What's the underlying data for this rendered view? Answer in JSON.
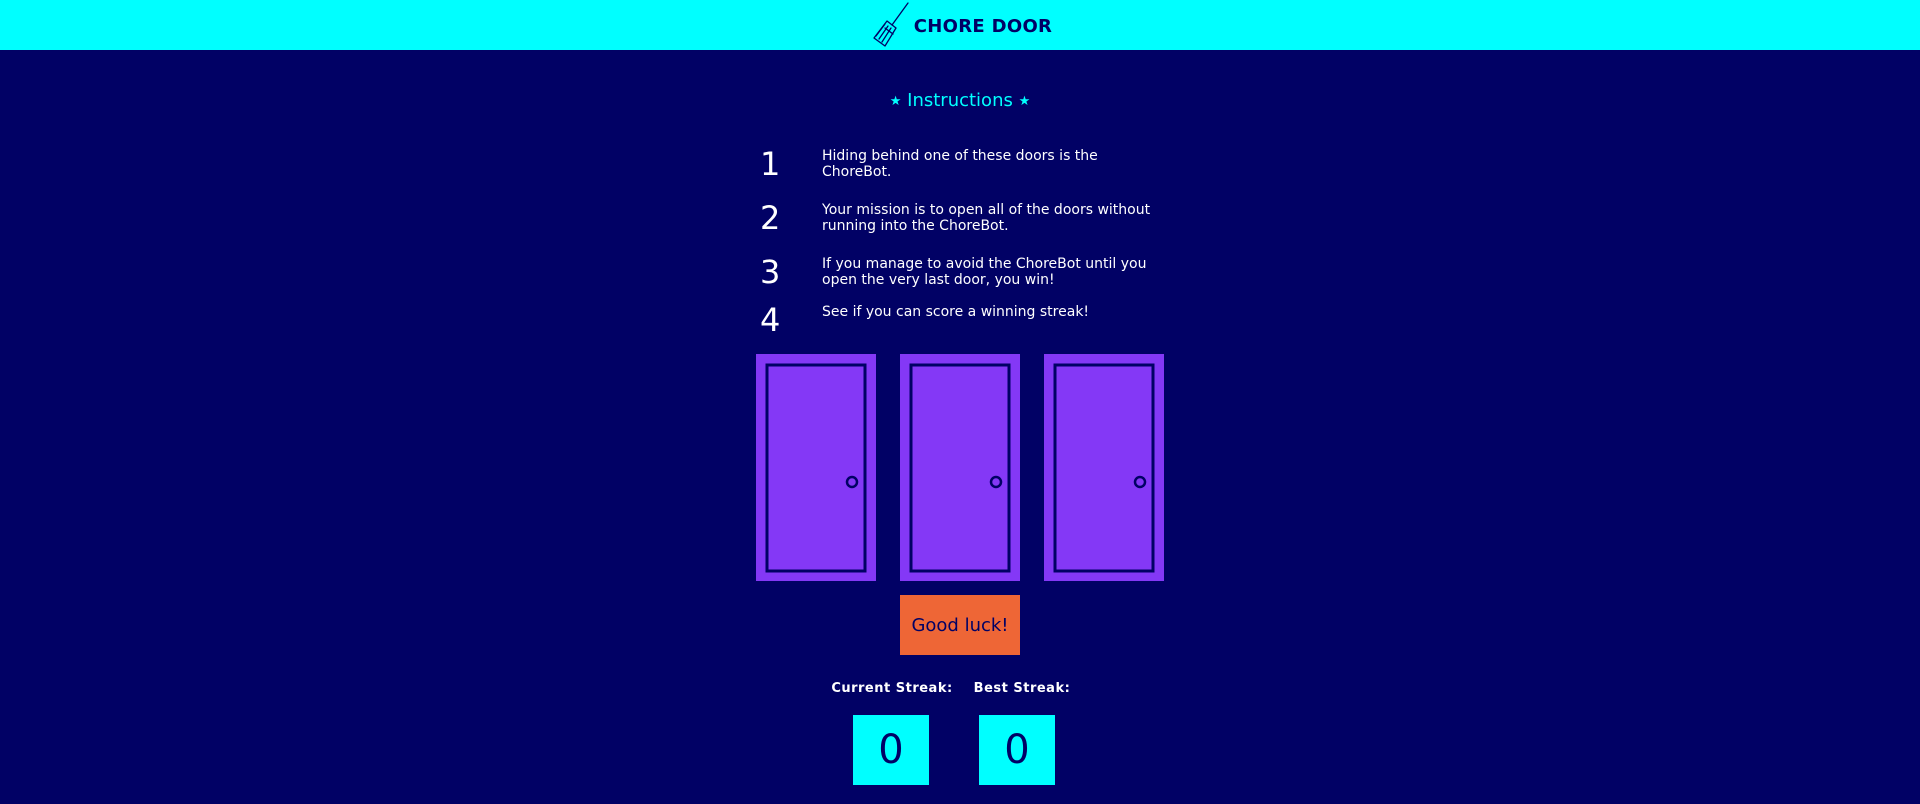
{
  "header": {
    "title": "CHORE DOOR",
    "icon": "broom-icon",
    "background_color": "#00FFFF"
  },
  "instructions": {
    "title": "Instructions",
    "star_glyph": "★",
    "items": [
      {
        "number": "1",
        "text": "Hiding behind one of these doors is the ChoreBot."
      },
      {
        "number": "2",
        "text": "Your mission is to open all of the doors without running into the ChoreBot."
      },
      {
        "number": "3",
        "text": "If you manage to avoid the ChoreBot until you open the very last door, you win!"
      },
      {
        "number": "4",
        "text": "See if you can score a winning streak!"
      }
    ]
  },
  "doors": [
    {
      "name": "door-1",
      "state": "closed"
    },
    {
      "name": "door-2",
      "state": "closed"
    },
    {
      "name": "door-3",
      "state": "closed"
    }
  ],
  "start_button": {
    "label": "Good luck!",
    "color": "#EE6636"
  },
  "score": {
    "current_label": "Current Streak:",
    "current_value": "0",
    "best_label": "Best Streak:",
    "best_value": "0"
  },
  "colors": {
    "background": "#010165",
    "accent": "#00FFFF",
    "door": "#8438F6",
    "button": "#EE6636"
  }
}
